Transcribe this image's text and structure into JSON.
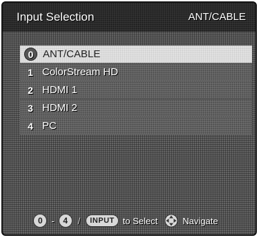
{
  "header": {
    "title": "Input Selection",
    "current_input": "ANT/CABLE"
  },
  "inputs": [
    {
      "number": "0",
      "label": "ANT/CABLE",
      "selected": true
    },
    {
      "number": "1",
      "label": "ColorStream HD",
      "selected": false
    },
    {
      "number": "2",
      "label": "HDMI 1",
      "selected": false
    },
    {
      "number": "3",
      "label": "HDMI 2",
      "selected": false
    },
    {
      "number": "4",
      "label": "PC",
      "selected": false
    }
  ],
  "footer": {
    "range_start": "0",
    "range_dash": "-",
    "range_end": "4",
    "separator": "/",
    "input_key": "INPUT",
    "select_text": "to Select",
    "navigate_text": "Navigate",
    "navigate_icon": "dpad-icon"
  }
}
